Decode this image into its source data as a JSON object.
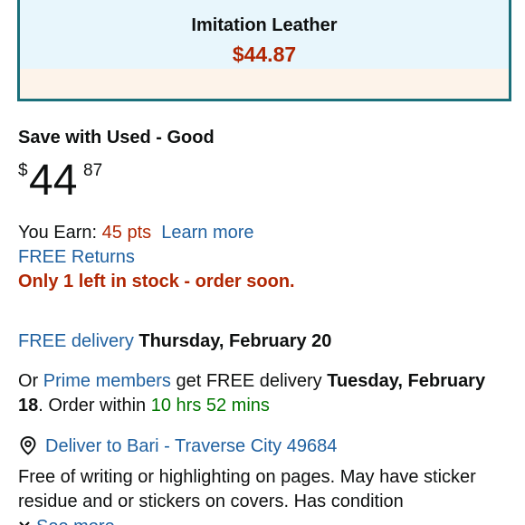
{
  "format": {
    "name": "Imitation Leather",
    "price": "$44.87"
  },
  "offer": {
    "heading": "Save with Used - Good",
    "price_symbol": "$",
    "price_whole": "44",
    "price_fraction": "87"
  },
  "points": {
    "label": "You Earn: ",
    "value": "45 pts",
    "learn_more": "Learn more"
  },
  "returns": "FREE Returns",
  "stock": "Only 1 left in stock - order soon.",
  "delivery": {
    "free_label": "FREE delivery",
    "free_date": "Thursday, February 20",
    "prime_prefix": "Or ",
    "prime_link": "Prime members",
    "prime_middle": " get FREE delivery ",
    "prime_date_part1": "Tuesday, February",
    "prime_date_part2": "18",
    "order_within_prefix": ". Order within ",
    "order_within_time": "10 hrs 52 mins"
  },
  "location": {
    "icon": "location-pin-icon",
    "label": "Deliver to Bari - Traverse City 49684"
  },
  "condition": {
    "line1": "Free of writing or highlighting on pages. May have sticker",
    "line2": "residue and or stickers on covers. Has condition",
    "see_more": "See more"
  },
  "colors": {
    "accent_border": "#1a6f7a",
    "price_red": "#b12704",
    "link_blue": "#2162a1",
    "green": "#007600"
  }
}
